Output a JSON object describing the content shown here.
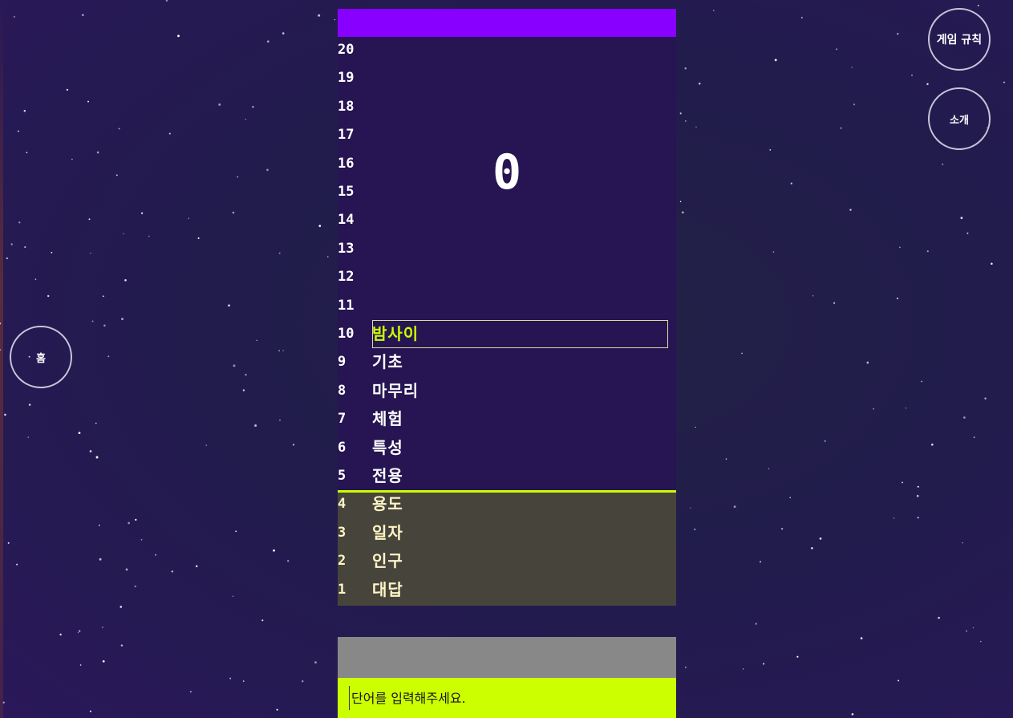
{
  "nav": {
    "rules_label": "게임 규칙",
    "about_label": "소개",
    "home_label": "홈"
  },
  "game": {
    "score": "0",
    "rows": [
      {
        "num": "20",
        "word": ""
      },
      {
        "num": "19",
        "word": ""
      },
      {
        "num": "18",
        "word": ""
      },
      {
        "num": "17",
        "word": ""
      },
      {
        "num": "16",
        "word": ""
      },
      {
        "num": "15",
        "word": ""
      },
      {
        "num": "14",
        "word": ""
      },
      {
        "num": "13",
        "word": ""
      },
      {
        "num": "12",
        "word": ""
      },
      {
        "num": "11",
        "word": ""
      },
      {
        "num": "10",
        "word": "밤사이"
      },
      {
        "num": "9",
        "word": "기초"
      },
      {
        "num": "8",
        "word": "마무리"
      },
      {
        "num": "7",
        "word": "체험"
      },
      {
        "num": "6",
        "word": "특성"
      },
      {
        "num": "5",
        "word": "전용"
      },
      {
        "num": "4",
        "word": "용도"
      },
      {
        "num": "3",
        "word": "일자"
      },
      {
        "num": "2",
        "word": "인구"
      },
      {
        "num": "1",
        "word": "대답"
      }
    ]
  },
  "input": {
    "placeholder": "단어를 입력해주세요.",
    "value": ""
  },
  "colors": {
    "accent_purple": "#8800ff",
    "accent_lime": "#ccff00",
    "stack_bg": "#261552",
    "danger_bg": "#47443c",
    "background": "#221c4a"
  }
}
